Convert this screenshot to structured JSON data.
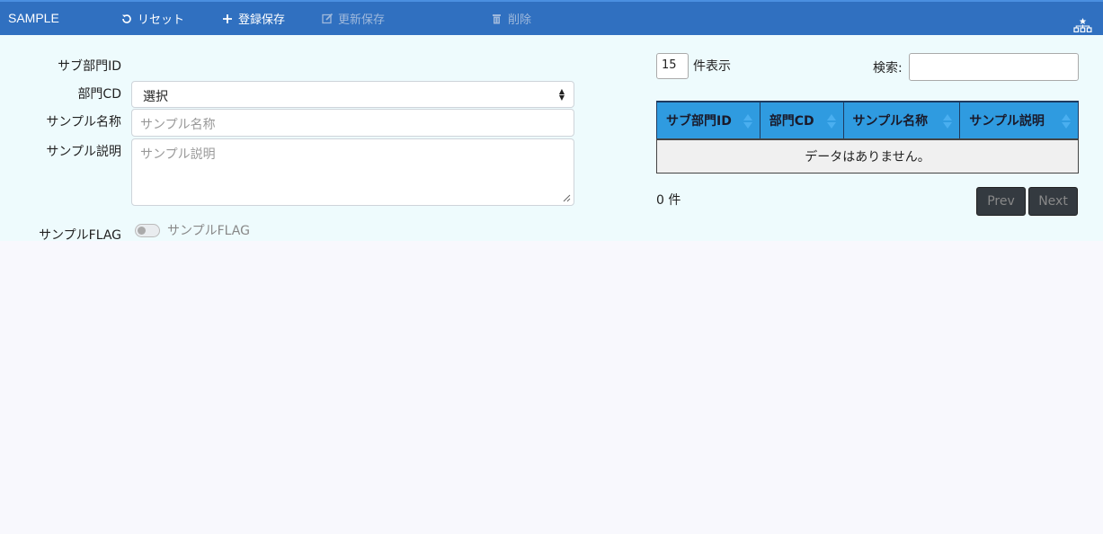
{
  "header": {
    "brand": "SAMPLE",
    "reset_label": "リセット",
    "register_label": "登録保存",
    "update_label": "更新保存",
    "delete_label": "削除"
  },
  "form": {
    "sub_dept_id_label": "サブ部門ID",
    "dept_cd_label": "部門CD",
    "dept_cd_value": "選択",
    "name_label": "サンプル名称",
    "name_placeholder": "サンプル名称",
    "desc_label": "サンプル説明",
    "desc_placeholder": "サンプル説明",
    "flag_label": "サンプルFLAG",
    "flag_toggle_label": "サンプルFLAG",
    "flag_on": false
  },
  "list": {
    "page_length": "15",
    "page_length_label": "件表示",
    "search_label": "検索:",
    "search_value": "",
    "columns": [
      "サブ部門ID",
      "部門CD",
      "サンプル名称",
      "サンプル説明"
    ],
    "empty_message": "データはありません。",
    "count_text": "0 件",
    "prev_label": "Prev",
    "next_label": "Next"
  },
  "colors": {
    "topbar": "#3070c0",
    "panel": "#eefbfd",
    "table_header": "#2f9be0"
  }
}
